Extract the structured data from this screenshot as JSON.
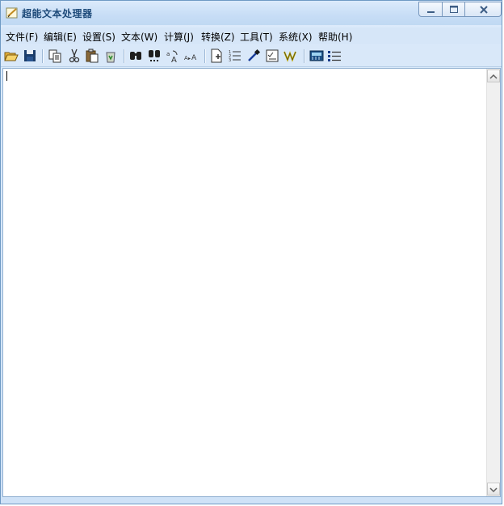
{
  "window": {
    "title": "超能文本处理器"
  },
  "menu": [
    "文件(F)",
    "编辑(E)",
    "设置(S)",
    "文本(W)",
    "计算(J)",
    "转换(Z)",
    "工具(T)",
    "系统(X)",
    "帮助(H)"
  ],
  "toolbar": [
    "open-icon",
    "save-icon",
    "copy-icon",
    "cut-icon",
    "paste-icon",
    "recycle-icon",
    "find-icon",
    "find-next-icon",
    "replace-icon",
    "font-size-icon",
    "new-doc-icon",
    "numbered-list-icon",
    "eyedropper-icon",
    "checklist-icon",
    "wave-icon",
    "calculator-icon",
    "bullet-list-icon"
  ],
  "editor": {
    "content": ""
  }
}
